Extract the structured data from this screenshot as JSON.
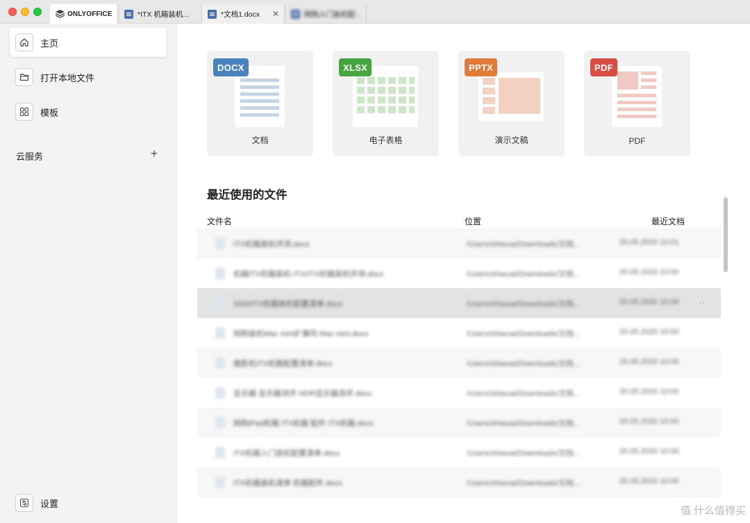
{
  "tabs": [
    {
      "label": "ONLYOFFICE"
    },
    {
      "label": "*ITX 机箱装机..."
    },
    {
      "label": "*文档1.docx"
    },
    {
      "label": "网购入门装机配..."
    }
  ],
  "sidebar": {
    "items": [
      {
        "label": "主页",
        "icon": "home-icon"
      },
      {
        "label": "打开本地文件",
        "icon": "folder-icon"
      },
      {
        "label": "模板",
        "icon": "grid-icon"
      }
    ],
    "cloud_label": "云服务",
    "cloud_add": "+",
    "settings_label": "设置"
  },
  "create": [
    {
      "badge": "DOCX",
      "label": "文档",
      "color": "#4a82bd"
    },
    {
      "badge": "XLSX",
      "label": "电子表格",
      "color": "#46a53e"
    },
    {
      "badge": "PPTX",
      "label": "演示文稿",
      "color": "#e07b39"
    },
    {
      "badge": "PDF",
      "label": "PDF",
      "color": "#d94e44"
    }
  ],
  "recent": {
    "title": "最近使用的文件",
    "col_name": "文件名",
    "col_location": "位置",
    "col_date": "最近文档",
    "rows": [
      {
        "name": "ITX机箱装机评测.docx",
        "path": "/Users/shiwuai/Downloads/文档...",
        "date": "20.05.2020 10:01"
      },
      {
        "name": "机箱ITX机箱装机-ITX/ITX机箱装机评测.docx",
        "path": "/Users/shiwuai/Downloads/文档...",
        "date": "20.05.2020 10:00"
      },
      {
        "name": "SSD/ITX机箱装机配置清单.docx",
        "path": "/Users/shiwuai/Downloads/文档...",
        "date": "20.05.2020 10:00"
      },
      {
        "name": "网购装机Mac mini扩展坞 Mac mini.docx",
        "path": "/Users/shiwuai/Downloads/文档...",
        "date": "20.05.2020 10:00"
      },
      {
        "name": "摄影机ITX机箱配置清单.docx",
        "path": "/Users/shiwuai/Downloads/文档...",
        "date": "20.05.2020 10:00"
      },
      {
        "name": "显示器 显示器测评 HDR显示器测评.docx",
        "path": "/Users/shiwuai/Downloads/文档...",
        "date": "20.05.2020 10:00"
      },
      {
        "name": "网购iPad机箱 ITX机箱 配件 ITX机箱.docx",
        "path": "/Users/shiwuai/Downloads/文档...",
        "date": "20.05.2020 10:00"
      },
      {
        "name": "ITX机箱入门装机配置清单.docx",
        "path": "/Users/shiwuai/Downloads/文档...",
        "date": "20.05.2020 10:00"
      },
      {
        "name": "ITX机箱装机清单 机箱配件.docx",
        "path": "/Users/shiwuai/Downloads/文档...",
        "date": "20.05.2020 10:00"
      }
    ],
    "more": "··"
  },
  "watermark": "值 什么值得买"
}
